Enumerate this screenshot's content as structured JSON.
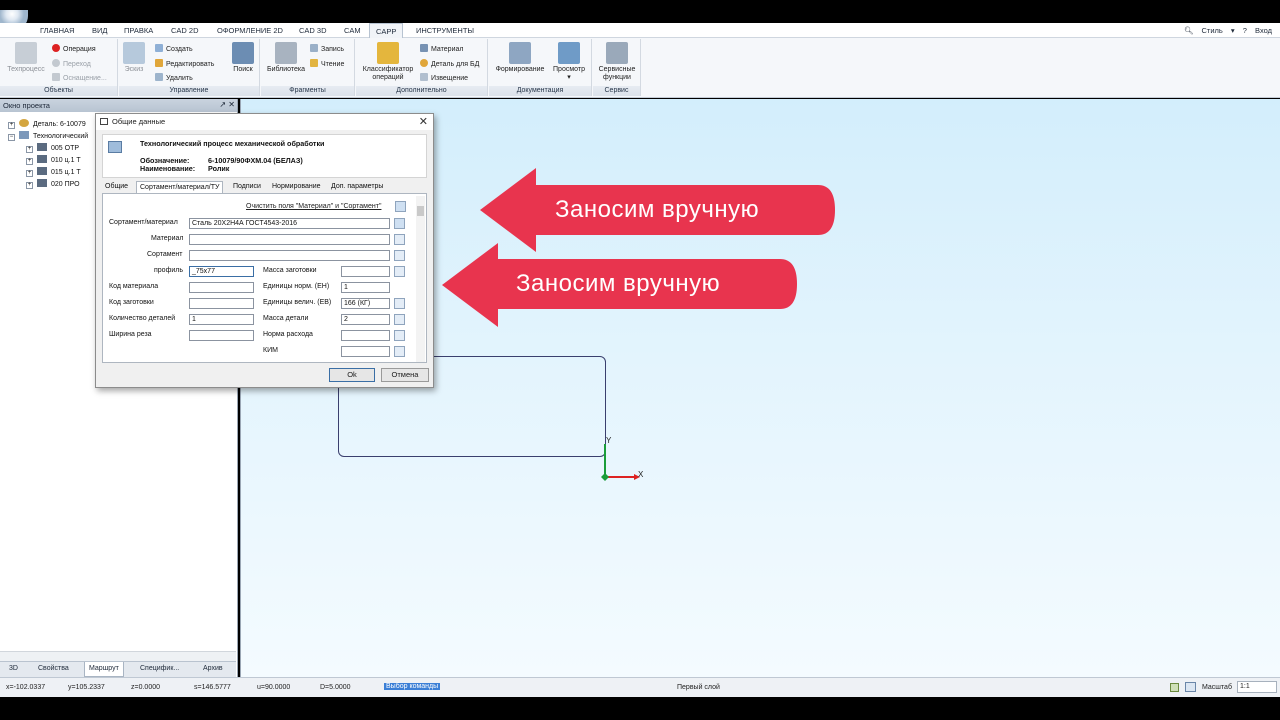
{
  "ribbon_tabs": [
    "ГЛАВНАЯ",
    "ВИД",
    "ПРАВКА",
    "CAD 2D",
    "ОФОРМЛЕНИЕ 2D",
    "CAD 3D",
    "CAM",
    "CAPP",
    "ИНСТРУМЕНТЫ"
  ],
  "active_tab": "CAPP",
  "ribbon_right": {
    "style_label": "Стиль",
    "login_label": "Вход"
  },
  "ribbon": {
    "objects": {
      "title": "Объекты",
      "techprocess": "Техпроцесс",
      "operation": "Операция",
      "transition": "Переход",
      "equipment": "Оснащение..."
    },
    "control": {
      "title": "Управление",
      "sketch": "Эскиз",
      "create": "Создать",
      "edit": "Редактировать",
      "delete": "Удалить",
      "search": "Поиск"
    },
    "fragments": {
      "title": "Фрагменты",
      "library": "Библиотека",
      "write": "Запись",
      "read": "Чтение"
    },
    "extra": {
      "title": "Дополнительно",
      "classifier_line1": "Классификатор",
      "classifier_line2": "операций",
      "material": "Материал",
      "part_for_db": "Деталь для БД",
      "notice": "Извещение"
    },
    "documentation": {
      "title": "Документация",
      "forming": "Формирование",
      "view": "Просмотр"
    },
    "service": {
      "title": "Сервис",
      "functions_line1": "Сервисные",
      "functions_line2": "функции"
    }
  },
  "project_panel": {
    "title": "Окно проекта",
    "tree": [
      {
        "label": "Деталь: 6-10079",
        "level": 0
      },
      {
        "label": "Технологический",
        "level": 0
      },
      {
        "label": "005  ОТР",
        "level": 1
      },
      {
        "label": "010 ц.1 Т",
        "level": 1
      },
      {
        "label": "015 ц.1 Т",
        "level": 1
      },
      {
        "label": "020  ПРО",
        "level": 1
      }
    ],
    "bottom_tabs": [
      "3D",
      "Свойства",
      "Маршрут",
      "Специфик...",
      "Архив"
    ],
    "active_bottom_tab": "Маршрут"
  },
  "annotations": {
    "arrow1_text": "Заносим вручную",
    "arrow2_text": "Заносим вручную",
    "arrow_color": "#e8344e"
  },
  "canvas": {
    "axis_x": "X",
    "axis_y": "Y"
  },
  "dialog": {
    "title": "Общие данные",
    "header": {
      "process_name": "Технологический процесс механической обработки",
      "designation_label": "Обозначение:",
      "designation_value": "6-10079/90ФХМ.04 (БЕЛАЗ)",
      "name_label": "Наименование:",
      "name_value": "Ролик"
    },
    "tabs": [
      "Общие",
      "Сортамент/материал/ТУ",
      "Подписи",
      "Нормирование",
      "Доп. параметры"
    ],
    "active_tab": "Сортамент/материал/ТУ",
    "clear_link": "Очистить поля \"Материал\" и \"Сортамент\"",
    "fields": {
      "sortament_material": {
        "label": "Сортамент/материал",
        "value": "Сталь 20Х2Н4А ГОСТ4543-2016"
      },
      "material": {
        "label": "Материал",
        "value": ""
      },
      "sortament": {
        "label": "Сортамент",
        "value": ""
      },
      "profile": {
        "label": "профиль",
        "value": "_75x77"
      },
      "material_code": {
        "label": "Код материала",
        "value": ""
      },
      "blank_code": {
        "label": "Код заготовки",
        "value": ""
      },
      "parts_count": {
        "label": "Количество деталей",
        "value": "1"
      },
      "cut_width": {
        "label": "Ширина реза",
        "value": ""
      },
      "blank_mass": {
        "label": "Масса заготовки",
        "value": ""
      },
      "norm_units": {
        "label": "Единицы норм. (ЕН)",
        "value": "1"
      },
      "value_units": {
        "label": "Единицы велич. (ЕВ)",
        "value": "166 (КГ)"
      },
      "part_mass": {
        "label": "Масса детали",
        "value": "2"
      },
      "consumption_norm": {
        "label": "Норма расхода",
        "value": ""
      },
      "kim": {
        "label": "КИМ",
        "value": ""
      }
    },
    "ok_label": "Ok",
    "cancel_label": "Отмена"
  },
  "status_bar": {
    "x": "x=-102.0337",
    "y": "y=105.2337",
    "z": "z=0.0000",
    "s": "s=146.5777",
    "u": "u=90.0000",
    "d": "D=5.0000",
    "command": "Выбор команды",
    "layer": "Первый слой",
    "scale_label": "Масштаб",
    "scale_value": "1:1"
  }
}
